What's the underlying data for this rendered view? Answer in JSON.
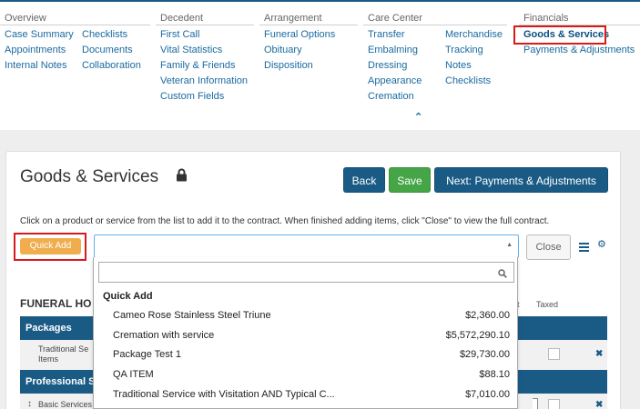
{
  "nav": {
    "groups": [
      {
        "title": "Overview",
        "columns": [
          [
            "Case Summary",
            "Appointments",
            "Internal Notes"
          ],
          [
            "Checklists",
            "Documents",
            "Collaboration"
          ]
        ]
      },
      {
        "title": "Decedent",
        "columns": [
          [
            "First Call",
            "Vital Statistics",
            "Family & Friends",
            "Veteran Information",
            "Custom Fields"
          ]
        ]
      },
      {
        "title": "Arrangement",
        "columns": [
          [
            "Funeral Options",
            "Obituary",
            "Disposition"
          ]
        ]
      },
      {
        "title": "Care Center",
        "columns": [
          [
            "Transfer",
            "Embalming",
            "Dressing",
            "Appearance",
            "Cremation"
          ],
          [
            "Merchandise",
            "Tracking",
            "Notes",
            "Checklists"
          ]
        ]
      },
      {
        "title": "Financials",
        "columns": [
          [
            "Goods & Services",
            "Payments & Adjustments"
          ]
        ]
      }
    ],
    "collapse_glyph": "⌃",
    "active_item": "Goods & Services"
  },
  "page": {
    "title": "Goods & Services",
    "instructions": "Click on a product or service from the list to add it to the contract. When finished adding items, click \"Close\" to view the full contract."
  },
  "toolbar": {
    "back_label": "Back",
    "save_label": "Save",
    "next_label": "Next: Payments & Adjustments",
    "quick_add_label": "Quick Add",
    "close_label": "Close"
  },
  "table": {
    "title": "FUNERAL HO",
    "col_partial": "t",
    "col_taxed": "Taxed",
    "sections": [
      "Packages",
      "Professional Se"
    ],
    "rows": [
      {
        "name_line1": "Traditional Se",
        "name_line2": "Items"
      },
      {
        "name": "Basic Services"
      }
    ]
  },
  "dropdown": {
    "search_value": "",
    "group_label": "Quick Add",
    "options": [
      {
        "name": "Cameo Rose Stainless Steel Triune",
        "price": "$2,360.00"
      },
      {
        "name": "Cremation with service",
        "price": "$5,572,290.10"
      },
      {
        "name": "Package Test 1",
        "price": "$29,730.00"
      },
      {
        "name": "QA ITEM",
        "price": "$88.10"
      },
      {
        "name": "Traditional Service with Visitation AND Typical C...",
        "price": "$7,010.00"
      }
    ]
  },
  "colors": {
    "primary": "#1a5b86",
    "success": "#46a546",
    "warning": "#f0ad4e",
    "highlight_box": "#d91a1a"
  },
  "icons": [
    "lock-icon",
    "chevron-up-icon",
    "list-icon",
    "gear-icon",
    "search-icon",
    "remove-icon",
    "drag-handle-icon"
  ]
}
